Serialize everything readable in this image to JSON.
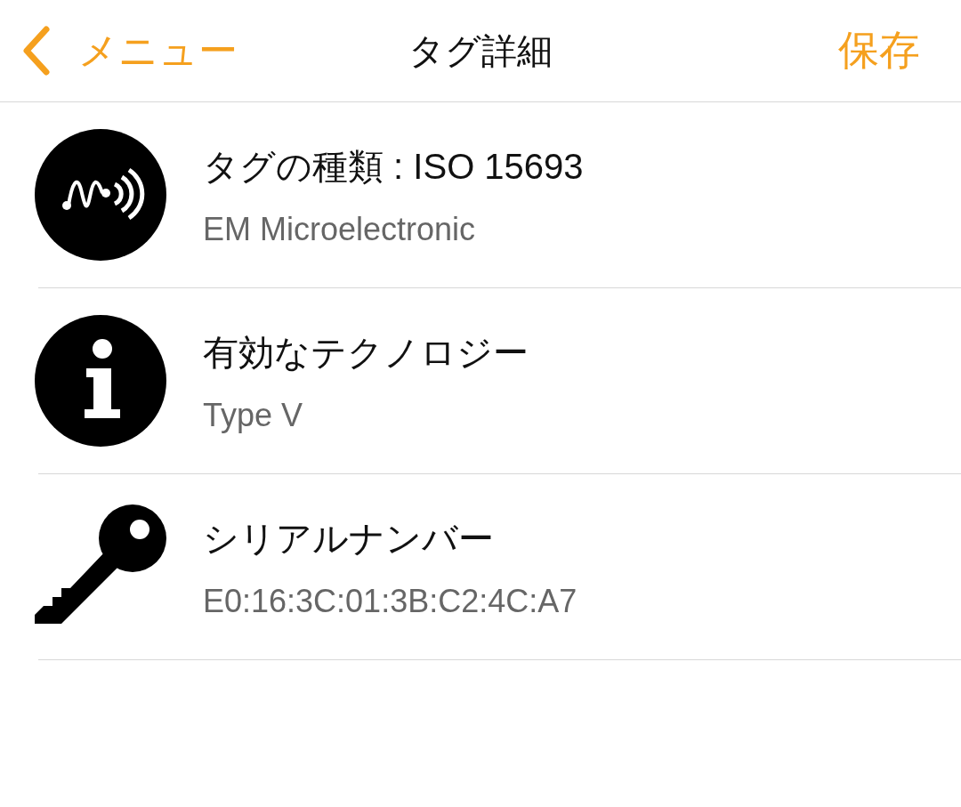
{
  "nav": {
    "back_label": "メニュー",
    "title": "タグ詳細",
    "action": "保存"
  },
  "rows": [
    {
      "kind": "tag",
      "title": "タグの種類 : ISO 15693",
      "subtitle": "EM Microelectronic"
    },
    {
      "kind": "info",
      "title": "有効なテクノロジー",
      "subtitle": "Type V"
    },
    {
      "kind": "key",
      "title": "シリアルナンバー",
      "subtitle": "E0:16:3C:01:3B:C2:4C:A7"
    }
  ]
}
